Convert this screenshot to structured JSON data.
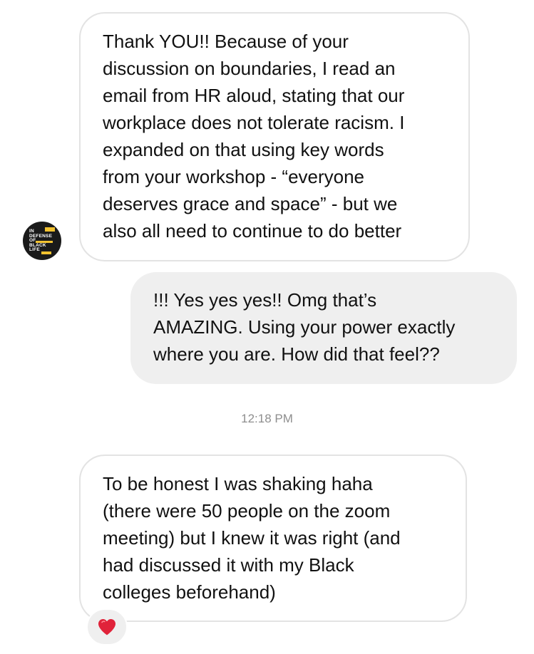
{
  "conversation": {
    "messages": [
      {
        "direction": "received",
        "text": "Thank YOU!! Because of your\ndiscussion on boundaries, I read an\nemail from HR aloud, stating that our\nworkplace does not tolerate racism. I\nexpanded on that using key words\nfrom your workshop - “everyone\ndeserves grace and space” - but we\nalso all need to continue to do better"
      },
      {
        "direction": "sent",
        "text": "!!! Yes yes yes!! Omg that’s\nAMAZING. Using your power exactly\nwhere you are. How did that feel??"
      },
      {
        "direction": "received",
        "text": "To be honest I was shaking haha\n(there were 50 people on the zoom\nmeeting) but I knew it was right (and\nhad discussed it with my Black\ncolleges beforehand)",
        "reaction": "red-heart"
      }
    ],
    "timestamp": "12:18 PM"
  },
  "avatar": {
    "logo_text": "IN\nDEFENSE\nOF\nBLACK\nLIFE",
    "colors": {
      "background": "#1a1a1a",
      "accent": "#f2c230"
    }
  },
  "colors": {
    "sent_bubble": "#efefef",
    "received_border": "#e3e3e3",
    "timestamp": "#8e8e8e",
    "heart": "#e0233a"
  }
}
